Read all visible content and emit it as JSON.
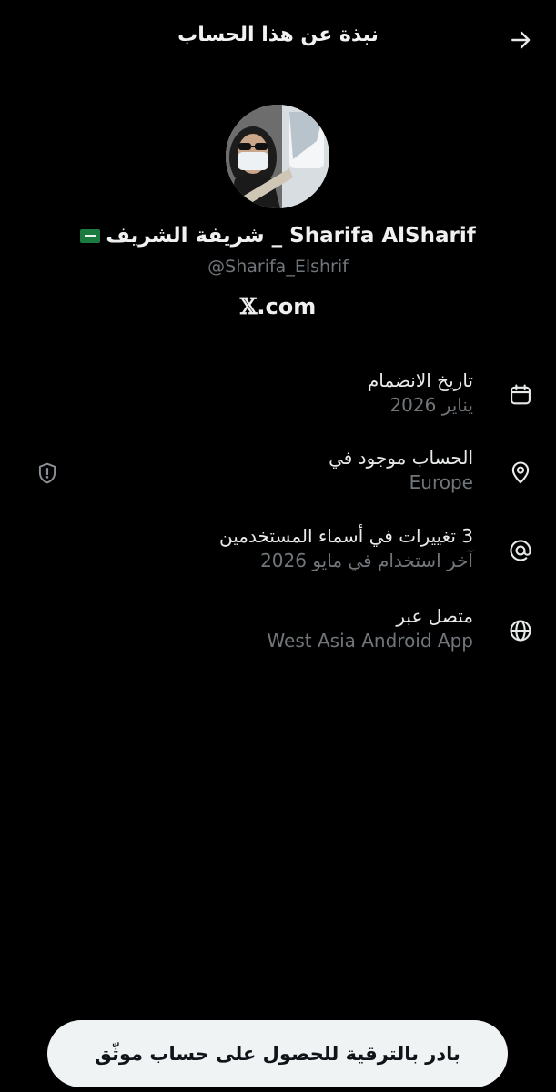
{
  "header": {
    "title": "نبذة عن هذا الحساب",
    "back_icon": "arrow-right-icon"
  },
  "profile": {
    "display_name": "Sharifa AlSharif _ شريفة الشريف",
    "flag_icon": "saudi-flag-icon",
    "handle": "@Sharifa_Elshrif",
    "site_mark": "𝕏",
    "site_suffix": ".com"
  },
  "info": [
    {
      "icon": "calendar-icon",
      "label": "تاريخ الانضمام",
      "value": "يناير 2026"
    },
    {
      "icon": "location-pin-icon",
      "label": "الحساب موجود في",
      "value": "Europe",
      "badge_icon": "shield-alert-icon"
    },
    {
      "icon": "at-sign-icon",
      "label": "3 تغييرات في أسماء المستخدمين",
      "value": "آخر استخدام في مايو 2026"
    },
    {
      "icon": "globe-icon",
      "label": "متصل عبر",
      "value": "West Asia Android App"
    }
  ],
  "cta": {
    "label": "بادر بالترقية للحصول على حساب موثّق"
  },
  "colors": {
    "background": "#000000",
    "primary_text": "#e7e9ea",
    "secondary_text": "#71767b",
    "button_bg": "#eff3f4"
  }
}
